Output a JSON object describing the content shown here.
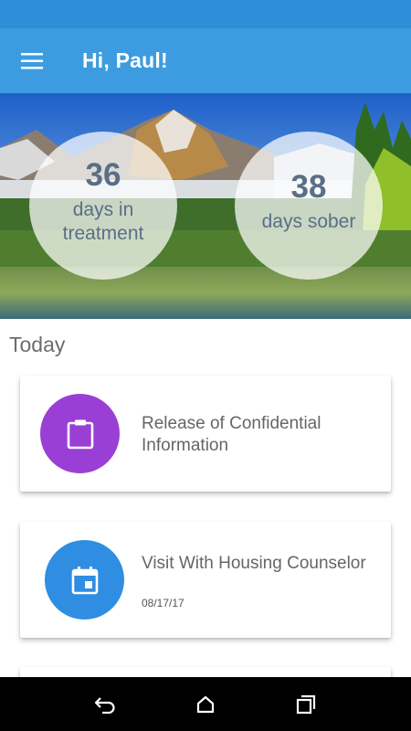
{
  "header": {
    "title": "Hi, Paul!"
  },
  "stats": [
    {
      "value": "36",
      "label": "days in treatment"
    },
    {
      "value": "38",
      "label": "days sober"
    }
  ],
  "today": {
    "heading": "Today",
    "items": [
      {
        "title": "Release of Confidential Information",
        "date": "",
        "icon": "clipboard-icon",
        "color": "#9a3fd6"
      },
      {
        "title": "Visit With Housing Counselor",
        "date": "08/17/17",
        "icon": "calendar-icon",
        "color": "#2f8ee2"
      }
    ]
  },
  "colors": {
    "status_bar": "#2f8ed8",
    "app_bar": "#3d9cdf",
    "stat_text": "#5a6e86"
  },
  "nav": {
    "icons": [
      "back-icon",
      "home-icon",
      "recents-icon"
    ]
  }
}
